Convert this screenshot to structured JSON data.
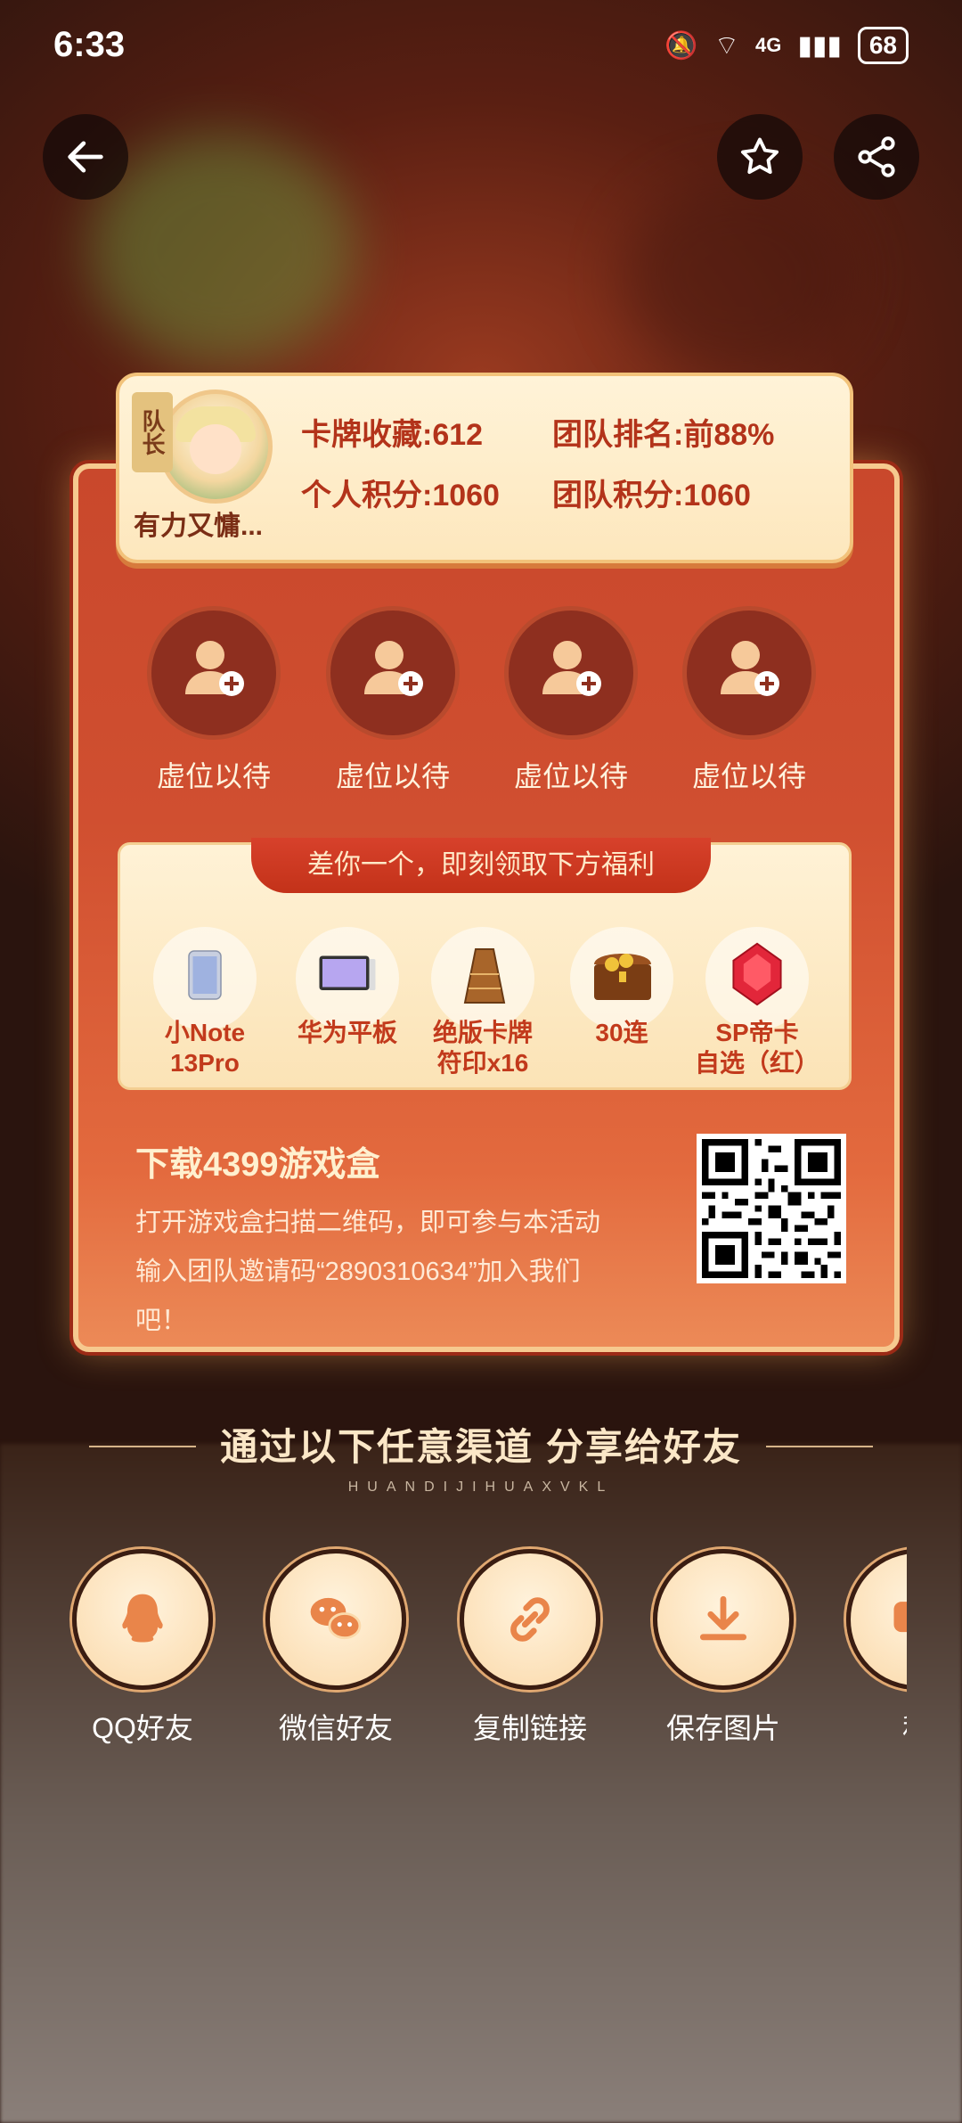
{
  "status_bar": {
    "time": "6:33",
    "battery": "68",
    "network": "4G"
  },
  "team_card": {
    "leader_tag": "队长",
    "nickname": "有力又慵...",
    "card_collection": "卡牌收藏:612",
    "team_rank": "团队排名:前88%",
    "personal_points": "个人积分:1060",
    "team_points": "团队积分:1060"
  },
  "members": [
    {
      "label": "虚位以待"
    },
    {
      "label": "虚位以待"
    },
    {
      "label": "虚位以待"
    },
    {
      "label": "虚位以待"
    }
  ],
  "rewards": {
    "banner": "差你一个，即刻领取下方福利",
    "items": [
      {
        "line1": "小Note",
        "line2": "13Pro"
      },
      {
        "line1": "华为平板",
        "line2": ""
      },
      {
        "line1": "绝版卡牌",
        "line2": "符印x16"
      },
      {
        "line1": "30连",
        "line2": ""
      },
      {
        "line1": "SP帝卡",
        "line2": "自选（红）"
      }
    ]
  },
  "download": {
    "title": "下载4399游戏盒",
    "line1": "打开游戏盒扫描二维码，即可参与本活动",
    "line2": "输入团队邀请码“2890310634”加入我们",
    "line3": "吧！"
  },
  "share": {
    "title": "通过以下任意渠道  分享给好友",
    "subtitle": "HUANDIJIHUAXVKL",
    "channels": [
      {
        "label": "QQ好友",
        "icon": "qq-icon"
      },
      {
        "label": "微信好友",
        "icon": "wechat-icon"
      },
      {
        "label": "复制链接",
        "icon": "link-icon"
      },
      {
        "label": "保存图片",
        "icon": "download-icon"
      },
      {
        "label": "私",
        "icon": "message-icon"
      }
    ]
  }
}
